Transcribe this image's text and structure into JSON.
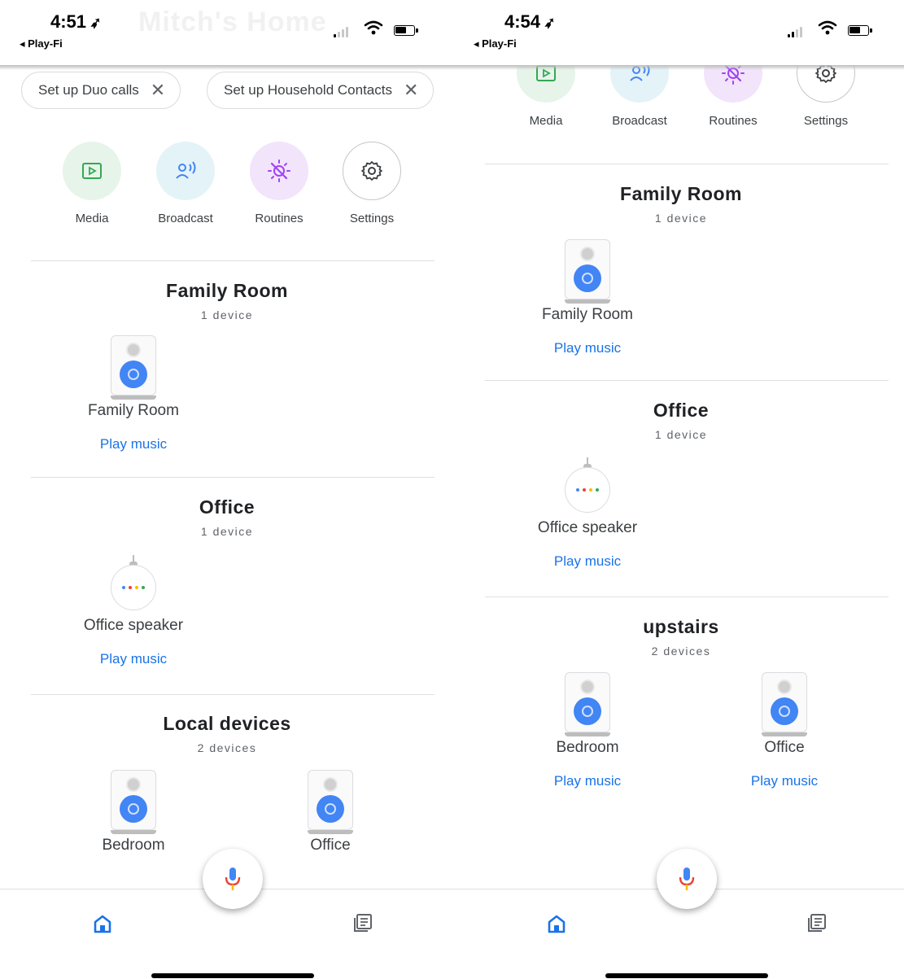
{
  "left": {
    "status": {
      "time": "4:51",
      "back": "◂ Play-Fi",
      "faded_title": "Mitch's Home"
    },
    "chips": [
      {
        "label": "Set up Duo calls"
      },
      {
        "label": "Set up Household Contacts"
      }
    ],
    "shortcuts": [
      {
        "label": "Media"
      },
      {
        "label": "Broadcast"
      },
      {
        "label": "Routines"
      },
      {
        "label": "Settings"
      }
    ],
    "rooms": [
      {
        "title": "Family Room",
        "count": "1 device",
        "devices": [
          {
            "name": "Family Room",
            "action": "Play music",
            "type": "speaker"
          }
        ]
      },
      {
        "title": "Office",
        "count": "1 device",
        "devices": [
          {
            "name": "Office speaker",
            "action": "Play music",
            "type": "mini"
          }
        ]
      },
      {
        "title": "Local devices",
        "count": "2 devices",
        "devices": [
          {
            "name": "Bedroom",
            "type": "speaker"
          },
          {
            "name": "Office",
            "type": "speaker"
          }
        ]
      }
    ]
  },
  "right": {
    "status": {
      "time": "4:54",
      "back": "◂ Play-Fi"
    },
    "shortcuts": [
      {
        "label": "Media"
      },
      {
        "label": "Broadcast"
      },
      {
        "label": "Routines"
      },
      {
        "label": "Settings"
      }
    ],
    "rooms": [
      {
        "title": "Family Room",
        "count": "1 device",
        "devices": [
          {
            "name": "Family Room",
            "action": "Play music",
            "type": "speaker"
          }
        ]
      },
      {
        "title": "Office",
        "count": "1 device",
        "devices": [
          {
            "name": "Office speaker",
            "action": "Play music",
            "type": "mini"
          }
        ]
      },
      {
        "title": "upstairs",
        "count": "2 devices",
        "devices": [
          {
            "name": "Bedroom",
            "action": "Play music",
            "type": "speaker"
          },
          {
            "name": "Office",
            "action": "Play music",
            "type": "speaker"
          }
        ]
      }
    ]
  },
  "colors": {
    "accent_blue": "#1a73e8",
    "speaker_blue": "#4285f4",
    "media_bg": "#e6f4ea",
    "broadcast_bg": "#e4f3f7",
    "routines_bg": "#f1e4fb",
    "mic_blue": "#4285f4",
    "mic_red": "#ea4335",
    "mic_yellow": "#fbbc04",
    "nav_active": "#1a73e8"
  },
  "icons": [
    "location-arrow-icon",
    "signal-icon",
    "wifi-icon",
    "battery-icon",
    "close-icon",
    "media-icon",
    "broadcast-icon",
    "routines-icon",
    "settings-icon",
    "speaker-icon",
    "mini-speaker-icon",
    "microphone-icon",
    "home-icon",
    "feed-icon"
  ]
}
